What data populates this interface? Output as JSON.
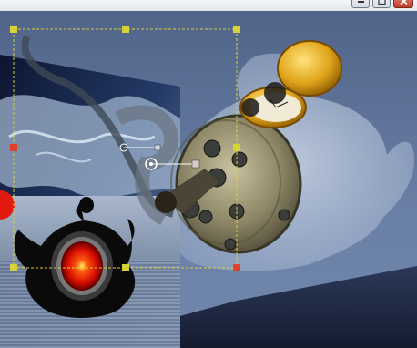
{
  "window": {
    "controls": [
      {
        "name": "minimize-button",
        "icon": "minimize-icon"
      },
      {
        "name": "maximize-button",
        "icon": "maximize-icon"
      },
      {
        "name": "close-button",
        "icon": "close-icon"
      }
    ]
  },
  "canvas": {
    "layers": [
      "background-scene",
      "teapot-silhouette-glow",
      "fabric-panel",
      "red-eye-teapot",
      "clockwork-machine",
      "pocket-watch"
    ],
    "selection": {
      "handle_style": "square",
      "line_color": "#d8d23a",
      "active_handle_color": "#e0402a"
    }
  },
  "colors": {
    "sky": "#5b6f95",
    "glow": "#b8c6d8",
    "metal": "#8a8464",
    "gold": "#d89a10",
    "eye_red": "#ff2a00",
    "panel_dark": "#0f1a33",
    "floor": "#1c2740"
  }
}
